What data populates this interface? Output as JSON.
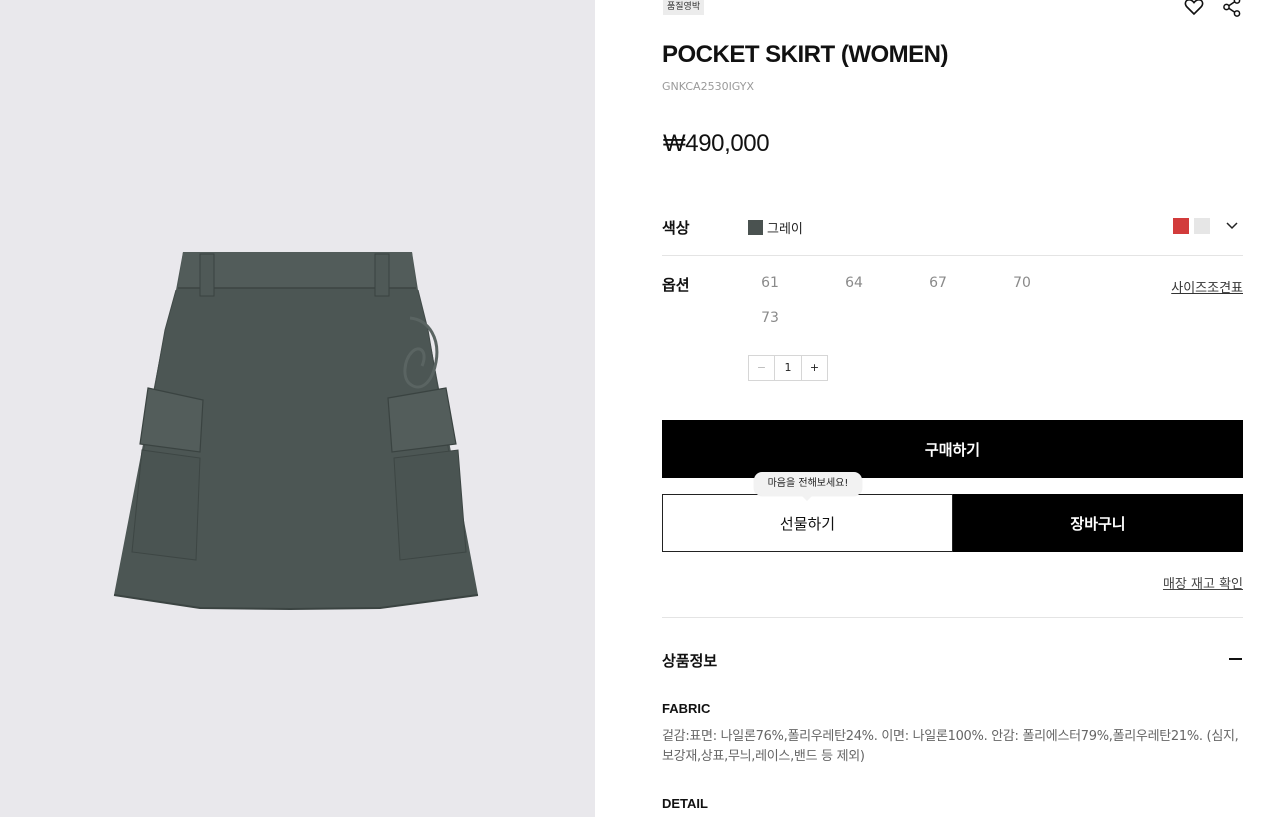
{
  "product": {
    "badge": "품질영박",
    "name": "POCKET SKIRT (WOMEN)",
    "code": "GNKCA2530IGYX",
    "price": "₩490,000"
  },
  "color": {
    "label": "색상",
    "selected_name": "그레이",
    "selected_hex": "#4a5250",
    "swatches": [
      "#d23b3b",
      "#e6e6e6"
    ]
  },
  "options": {
    "label": "옵션",
    "sizes": [
      "61",
      "64",
      "67",
      "70",
      "73"
    ],
    "size_chart_link": "사이즈조견표",
    "quantity": "1",
    "minus": "−",
    "plus": "+"
  },
  "actions": {
    "buy": "구매하기",
    "gift": "선물하기",
    "gift_tooltip": "마음을 전해보세요!",
    "cart": "장바구니",
    "store_stock": "매장 재고 확인"
  },
  "info": {
    "title": "상품정보",
    "fabric_title": "FABRIC",
    "fabric_text": "겉감:표면: 나일론76%,폴리우레탄24%. 이면: 나일론100%. 안감: 폴리에스터79%,폴리우레탄21%. (심지,보강재,상표,무늬,레이스,밴드 등 제외)",
    "detail_title": "DETAIL"
  },
  "icons": {
    "wishlist": "heart-icon",
    "share": "share-icon",
    "dropdown": "chevron-down-icon",
    "collapse": "minus-icon"
  }
}
